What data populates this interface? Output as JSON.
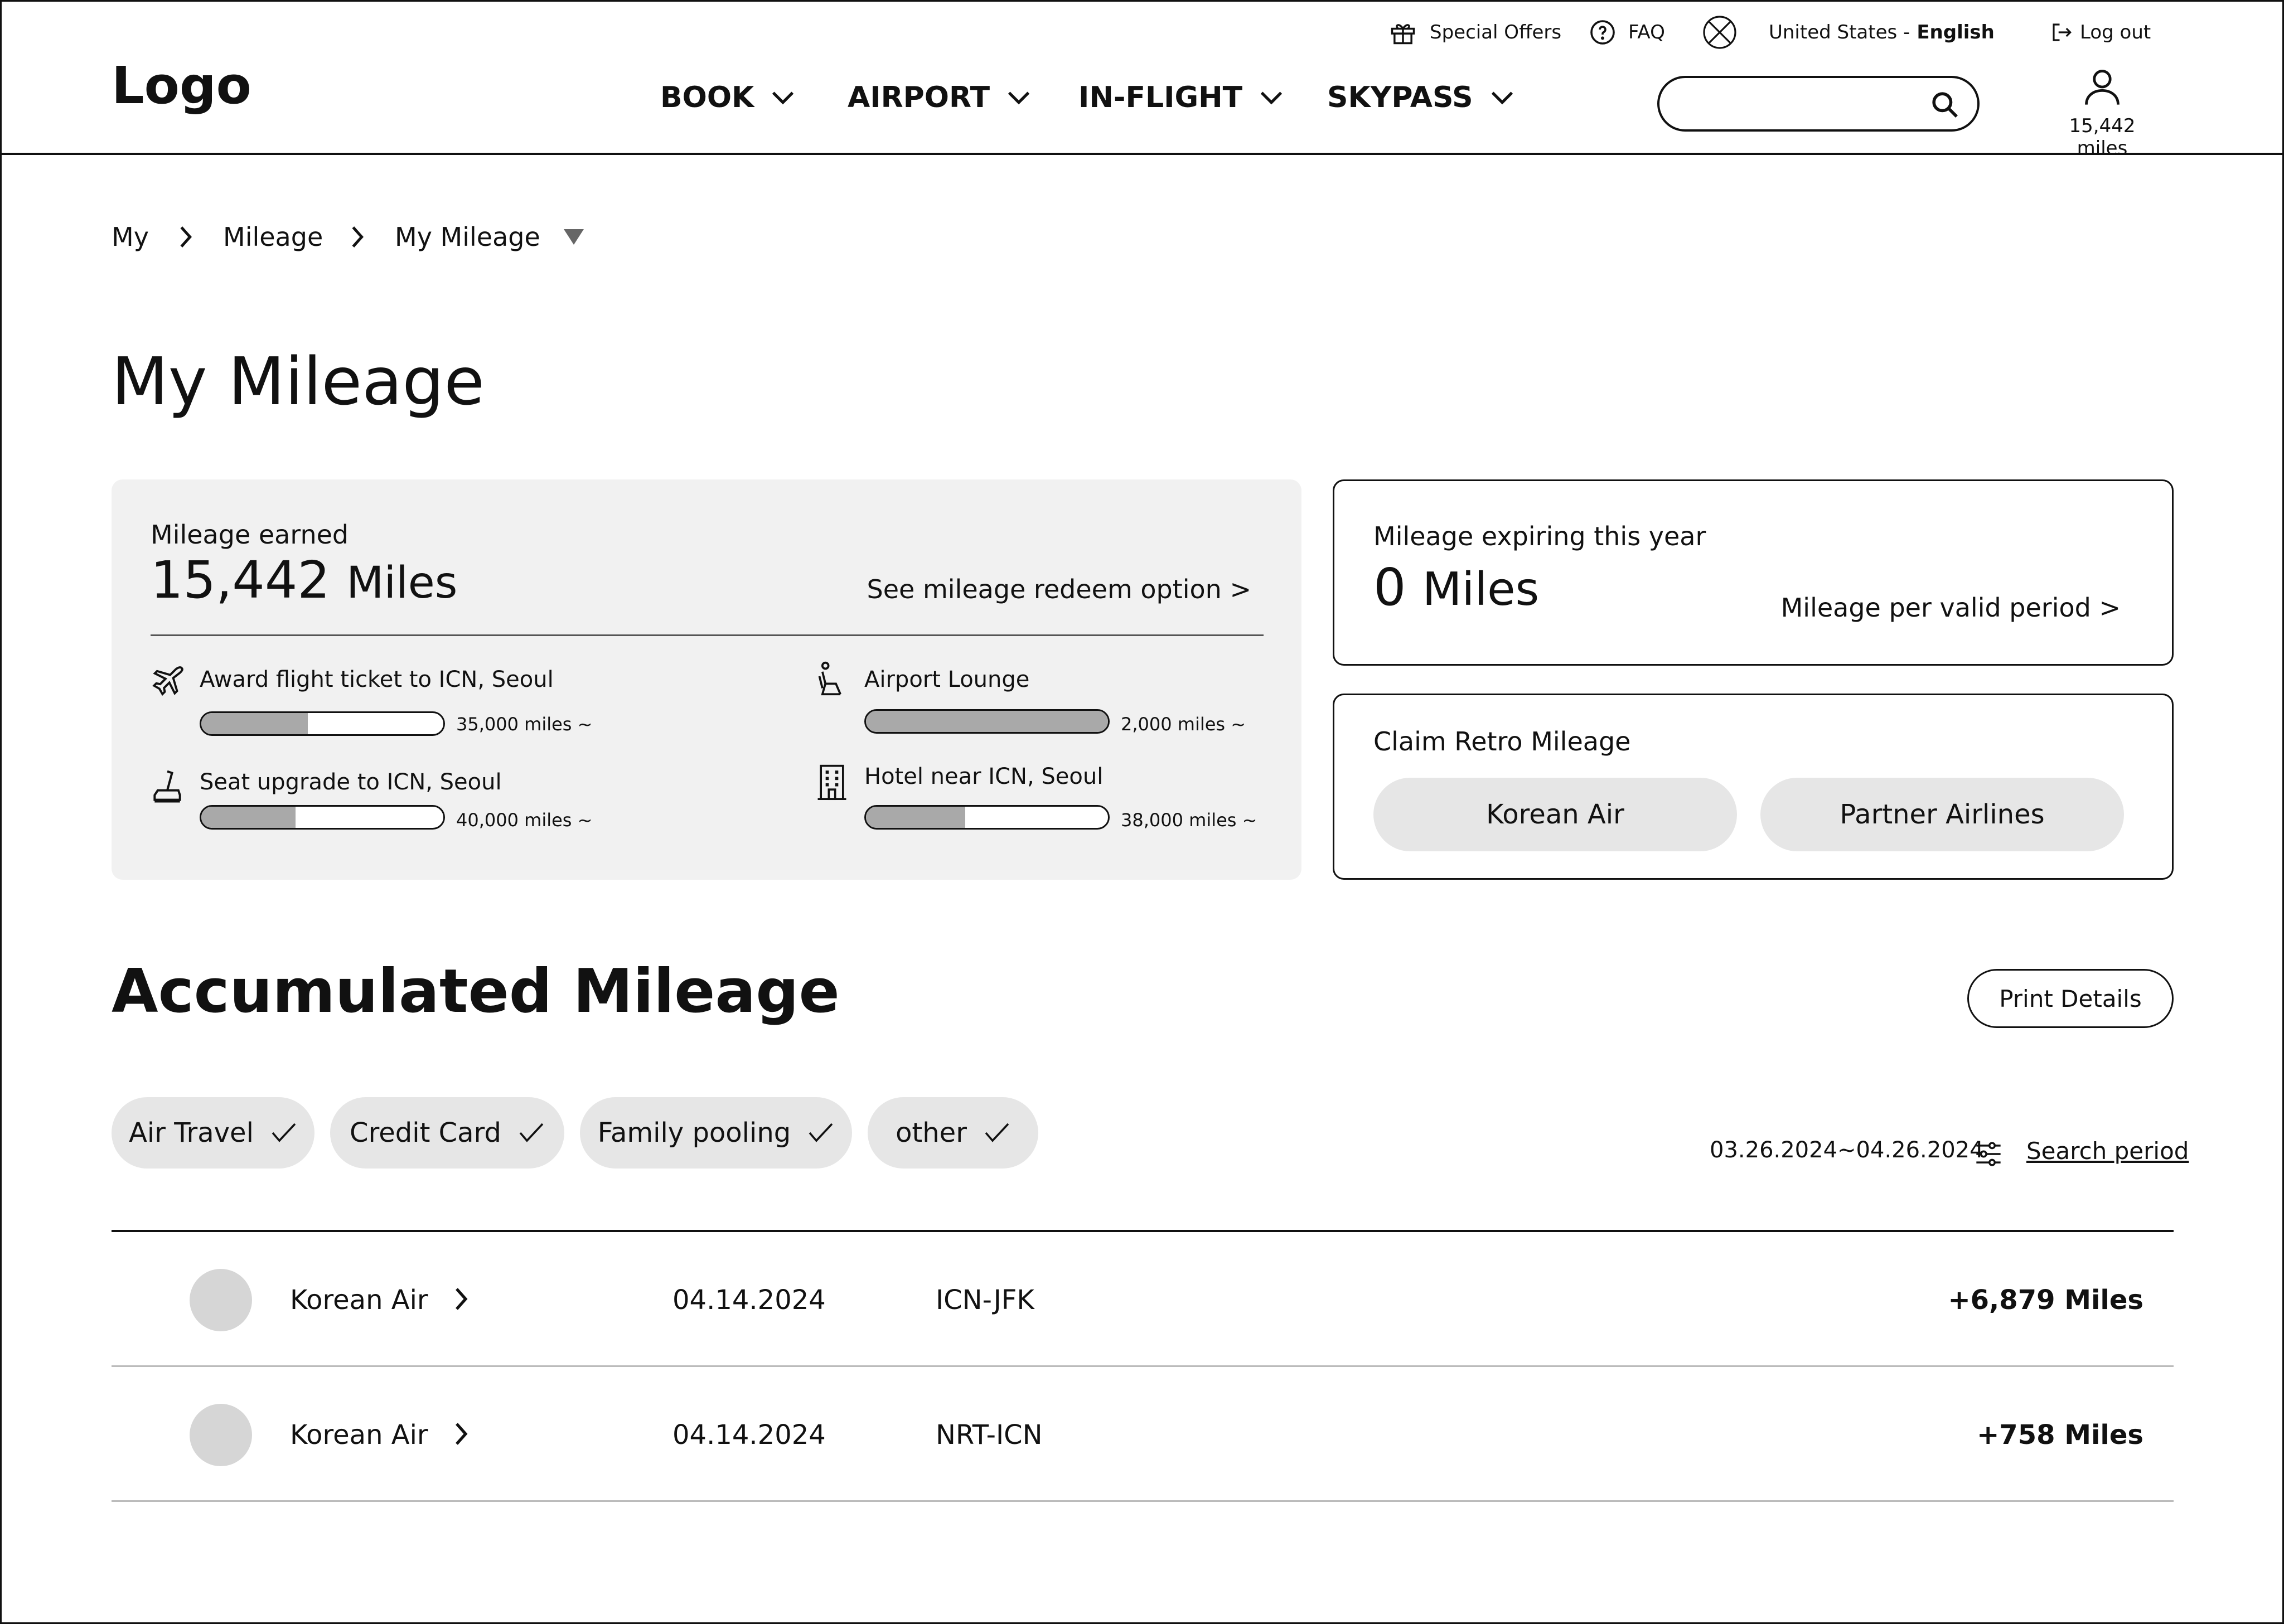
{
  "header": {
    "utility": {
      "special_offers": "Special Offers",
      "faq": "FAQ",
      "region": "United States - ",
      "language": "English",
      "logout": "Log out"
    },
    "logo": "Logo",
    "nav": [
      "BOOK",
      "AIRPORT",
      "IN-FLIGHT",
      "SKYPASS"
    ],
    "search": {
      "value": "",
      "placeholder": ""
    },
    "profile_miles": "15,442 miles"
  },
  "breadcrumb": [
    "My",
    "Mileage",
    "My Mileage"
  ],
  "page_title": "My Mileage",
  "earned": {
    "label": "Mileage earned",
    "value": "15,442",
    "unit": "Miles",
    "redeem_link": "See mileage redeem option  >",
    "rewards": [
      {
        "label": "Award flight ticket to ICN, Seoul",
        "requirement": "35,000 miles ~",
        "progress": 0.44,
        "icon": "airplane-icon"
      },
      {
        "label": "Airport Lounge",
        "requirement": "2,000 miles ~",
        "progress": 1.0,
        "icon": "lounge-seat-icon"
      },
      {
        "label": "Seat upgrade to ICN, Seoul",
        "requirement": "40,000 miles ~",
        "progress": 0.39,
        "icon": "seat-icon"
      },
      {
        "label": "Hotel near ICN, Seoul",
        "requirement": "38,000 miles ~",
        "progress": 0.41,
        "icon": "building-icon"
      }
    ]
  },
  "expiring": {
    "label": "Mileage expiring this year",
    "value": "0",
    "unit": "Miles",
    "link": "Mileage per valid period  >"
  },
  "retro": {
    "label": "Claim Retro Mileage",
    "buttons": [
      "Korean Air",
      "Partner Airlines"
    ]
  },
  "accumulated": {
    "title": "Accumulated Mileage",
    "print_button": "Print Details",
    "filters": [
      "Air Travel",
      "Credit Card",
      "Family pooling",
      "other"
    ],
    "period": "03.26.2024~04.26.2024",
    "period_link": "Search period",
    "rows": [
      {
        "airline": "Korean Air",
        "date": "04.14.2024",
        "route": "ICN-JFK",
        "amount": "+6,879 Miles"
      },
      {
        "airline": "Korean Air",
        "date": "04.14.2024",
        "route": "NRT-ICN",
        "amount": "+758 Miles"
      }
    ]
  }
}
